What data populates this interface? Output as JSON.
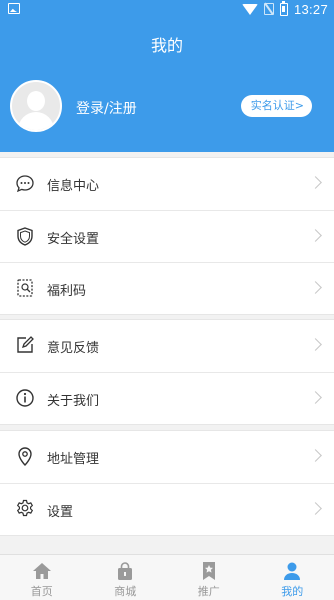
{
  "status_bar": {
    "time": "13:27"
  },
  "header": {
    "title": "我的",
    "login_label": "登录/注册",
    "verify_button": "实名认证>"
  },
  "menu_groups": [
    {
      "items": [
        {
          "label": "信息中心",
          "icon": "message-icon"
        },
        {
          "label": "安全设置",
          "icon": "shield-icon"
        },
        {
          "label": "福利码",
          "icon": "coupon-code-icon"
        }
      ]
    },
    {
      "items": [
        {
          "label": "意见反馈",
          "icon": "edit-icon"
        },
        {
          "label": "关于我们",
          "icon": "info-icon"
        }
      ]
    },
    {
      "items": [
        {
          "label": "地址管理",
          "icon": "location-pin-icon"
        },
        {
          "label": "设置",
          "icon": "gear-icon"
        }
      ]
    }
  ],
  "tabbar": {
    "active_index": 3,
    "tabs": [
      {
        "label": "首页",
        "icon": "home-icon"
      },
      {
        "label": "商城",
        "icon": "shopping-bag-icon"
      },
      {
        "label": "推广",
        "icon": "bookmark-star-icon"
      },
      {
        "label": "我的",
        "icon": "person-icon"
      }
    ]
  },
  "colors": {
    "primary": "#3d9bea",
    "background": "#f2f2f2",
    "inactive": "#999999",
    "text": "#333333"
  }
}
